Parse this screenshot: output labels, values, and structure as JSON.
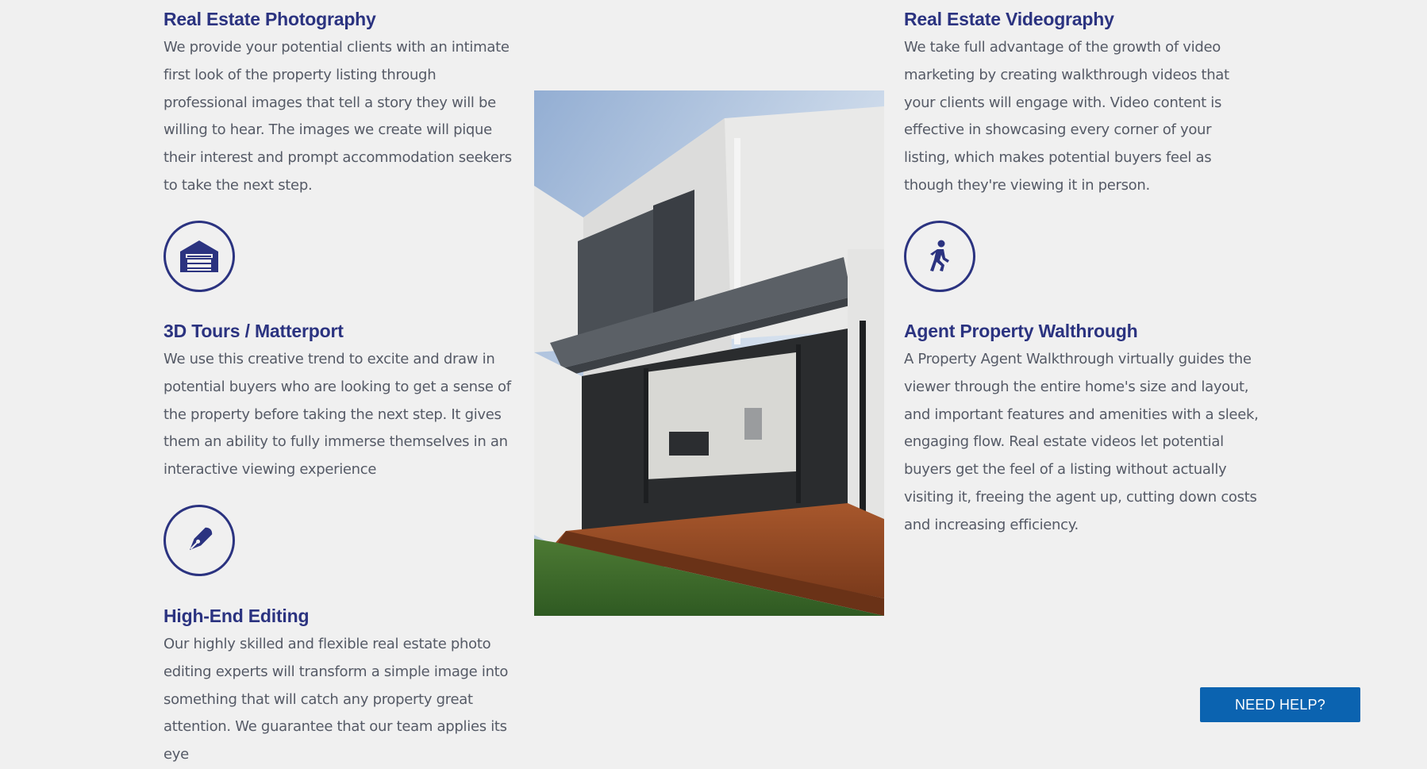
{
  "services": {
    "photography": {
      "title": "Real Estate Photography",
      "text": "We provide your potential clients with an intimate first look of the property listing through professional images that tell a story they will be willing to hear. The images we create will pique their interest and prompt accommodation seekers to take the next step."
    },
    "tours": {
      "title": "3D Tours / Matterport",
      "text": "We use this creative trend to excite and draw in potential buyers who are looking to get a sense of the property before taking the next step. It gives them an ability to fully immerse themselves in an interactive viewing experience"
    },
    "editing": {
      "title": "High-End Editing",
      "text": "Our highly skilled and flexible real estate photo editing experts will transform a simple image into something that will catch any property great attention. We guarantee that our team applies its eye"
    },
    "videography": {
      "title": "Real Estate Videography",
      "text": "We take full advantage of the growth of video marketing by creating walkthrough videos that your clients will engage with. Video content is effective in showcasing every corner of your listing, which makes potential buyers feel as though they're viewing it in person."
    },
    "walkthrough": {
      "title": "Agent Property Walthrough",
      "text": "A Property Agent Walkthrough virtually guides the viewer through the entire home's size and layout, and important features and amenities with a sleek, engaging flow. Real estate videos let potential buyers get the feel of a listing without actually visiting it, freeing the agent up, cutting down costs and increasing efficiency."
    }
  },
  "icons": {
    "garage": "garage-icon",
    "pen": "pen-nib-icon",
    "walk": "walking-person-icon"
  },
  "help_button": {
    "label": "NEED HELP?"
  },
  "colors": {
    "accent": "#2b3380",
    "button": "#0b63b0",
    "background": "#f0f0f0",
    "body_text": "#555a66"
  }
}
